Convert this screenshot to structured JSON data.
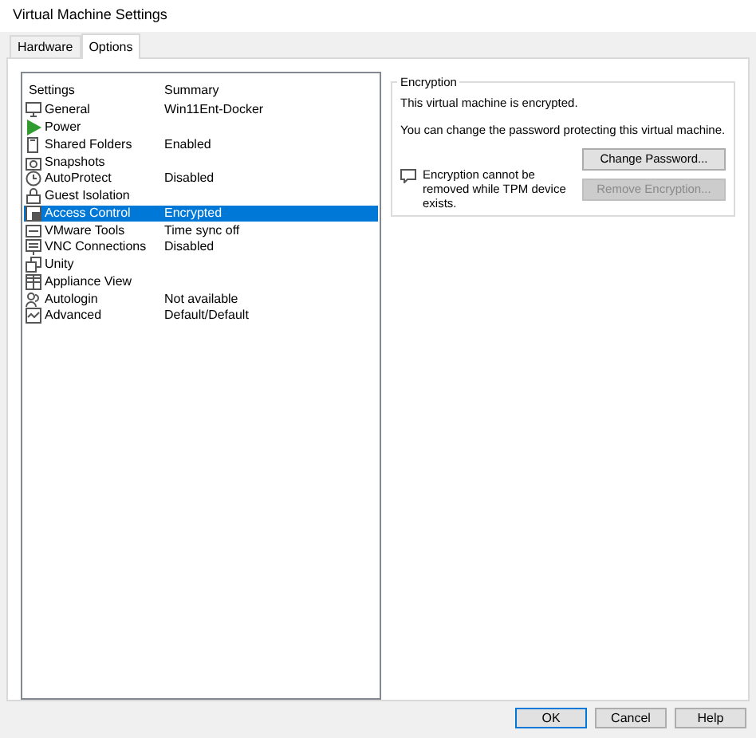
{
  "window": {
    "title": "Virtual Machine Settings"
  },
  "tabs": [
    {
      "label": "Hardware",
      "selected": false
    },
    {
      "label": "Options",
      "selected": true
    }
  ],
  "settings_list": {
    "columns": [
      "Settings",
      "Summary"
    ],
    "rows": [
      {
        "name": "General",
        "summary": "Win11Ent-Docker",
        "selected": false
      },
      {
        "name": "Power",
        "summary": "",
        "selected": false
      },
      {
        "name": "Shared Folders",
        "summary": "Enabled",
        "selected": false
      },
      {
        "name": "Snapshots",
        "summary": "",
        "selected": false
      },
      {
        "name": "AutoProtect",
        "summary": "Disabled",
        "selected": false
      },
      {
        "name": "Guest Isolation",
        "summary": "",
        "selected": false
      },
      {
        "name": "Access Control",
        "summary": "Encrypted",
        "selected": true
      },
      {
        "name": "VMware Tools",
        "summary": "Time sync off",
        "selected": false
      },
      {
        "name": "VNC Connections",
        "summary": "Disabled",
        "selected": false
      },
      {
        "name": "Unity",
        "summary": "",
        "selected": false
      },
      {
        "name": "Appliance View",
        "summary": "",
        "selected": false
      },
      {
        "name": "Autologin",
        "summary": "Not available",
        "selected": false
      },
      {
        "name": "Advanced",
        "summary": "Default/Default",
        "selected": false
      }
    ]
  },
  "encryption": {
    "title": "Encryption",
    "status": "This virtual machine is encrypted.",
    "info": "You can change the password protecting this virtual machine.",
    "buttons": [
      {
        "label": "Change Password...",
        "disabled": false
      },
      {
        "label": "Remove Encryption...",
        "disabled": true
      }
    ],
    "note": "Encryption cannot be removed while TPM device exists."
  },
  "buttons": [
    {
      "label": "OK",
      "default": true
    },
    {
      "label": "Cancel",
      "default": false
    },
    {
      "label": "Help",
      "default": false
    }
  ]
}
